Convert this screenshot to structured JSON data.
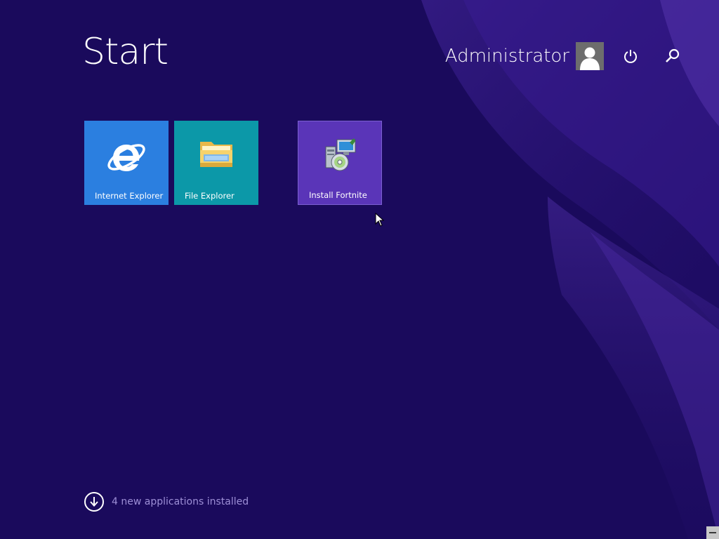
{
  "screen": {
    "title": "Start",
    "background_color": "#1a0a5c",
    "accent_color": "#4b2aa8"
  },
  "header": {
    "user_name": "Administrator",
    "avatar_icon": "user-silhouette-icon",
    "power_icon": "power-icon",
    "search_icon": "search-icon"
  },
  "tiles": [
    {
      "label": "Internet Explorer",
      "icon": "internet-explorer-icon",
      "color": "#2b7fe0"
    },
    {
      "label": "File Explorer",
      "icon": "folder-icon",
      "color": "#0c98a8"
    },
    {
      "label": "Install Fortnite",
      "icon": "installer-icon",
      "color": "#5a35b8"
    }
  ],
  "footer": {
    "apps_notice": "4 new applications installed",
    "apps_notice_icon": "arrow-down-circle-icon"
  }
}
